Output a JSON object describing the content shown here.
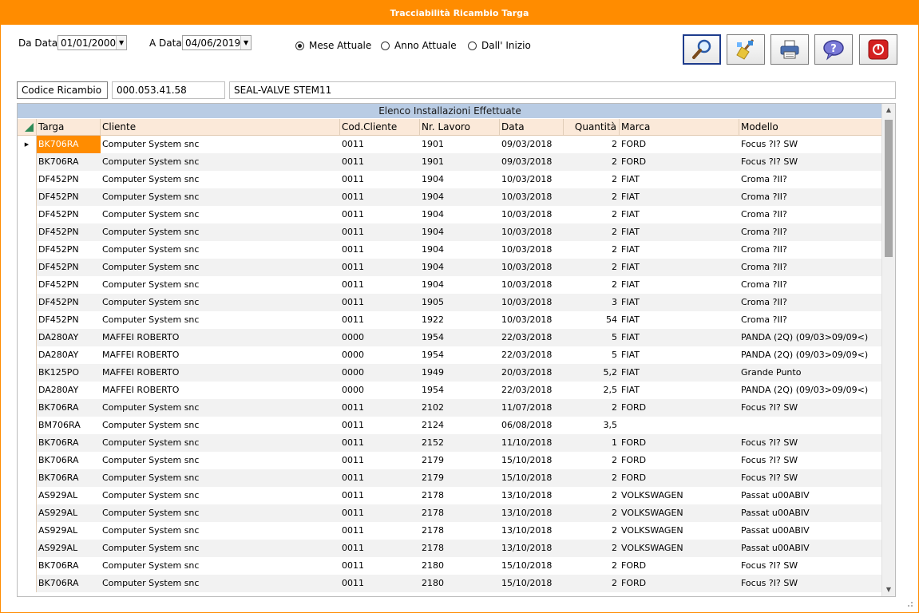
{
  "window": {
    "title": "Tracciabilità Ricambio Targa"
  },
  "filters": {
    "da_data_label": "Da Data",
    "da_data_value": "01/01/2000",
    "a_data_label": "A Data",
    "a_data_value": "04/06/2019",
    "radios": [
      {
        "label": "Mese Attuale",
        "checked": true
      },
      {
        "label": "Anno Attuale",
        "checked": false
      },
      {
        "label": "Dall' Inizio",
        "checked": false
      }
    ]
  },
  "toolbar": {
    "search_icon": "magnifier-icon",
    "clear_icon": "broom-icon",
    "print_icon": "printer-icon",
    "help_icon": "help-bubble-icon",
    "exit_icon": "power-off-icon"
  },
  "part": {
    "label": "Codice Ricambio",
    "code": "000.053.41.58",
    "description": "SEAL-VALVE STEM11"
  },
  "grid": {
    "caption": "Elenco Installazioni Effettuate",
    "columns": [
      "Targa",
      "Cliente",
      "Cod.Cliente",
      "Nr. Lavoro",
      "Data",
      "Quantità",
      "Marca",
      "Modello"
    ],
    "rows": [
      [
        "BK706RA",
        "Computer System snc",
        "0011",
        "1901",
        "09/03/2018",
        "2",
        "FORD",
        "Focus ?I? SW"
      ],
      [
        "BK706RA",
        "Computer System snc",
        "0011",
        "1901",
        "09/03/2018",
        "2",
        "FORD",
        "Focus ?I? SW"
      ],
      [
        "DF452PN",
        "Computer System snc",
        "0011",
        "1904",
        "10/03/2018",
        "2",
        "FIAT",
        "Croma ?II?"
      ],
      [
        "DF452PN",
        "Computer System snc",
        "0011",
        "1904",
        "10/03/2018",
        "2",
        "FIAT",
        "Croma ?II?"
      ],
      [
        "DF452PN",
        "Computer System snc",
        "0011",
        "1904",
        "10/03/2018",
        "2",
        "FIAT",
        "Croma ?II?"
      ],
      [
        "DF452PN",
        "Computer System snc",
        "0011",
        "1904",
        "10/03/2018",
        "2",
        "FIAT",
        "Croma ?II?"
      ],
      [
        "DF452PN",
        "Computer System snc",
        "0011",
        "1904",
        "10/03/2018",
        "2",
        "FIAT",
        "Croma ?II?"
      ],
      [
        "DF452PN",
        "Computer System snc",
        "0011",
        "1904",
        "10/03/2018",
        "2",
        "FIAT",
        "Croma ?II?"
      ],
      [
        "DF452PN",
        "Computer System snc",
        "0011",
        "1904",
        "10/03/2018",
        "2",
        "FIAT",
        "Croma ?II?"
      ],
      [
        "DF452PN",
        "Computer System snc",
        "0011",
        "1905",
        "10/03/2018",
        "3",
        "FIAT",
        "Croma ?II?"
      ],
      [
        "DF452PN",
        "Computer System snc",
        "0011",
        "1922",
        "10/03/2018",
        "54",
        "FIAT",
        "Croma ?II?"
      ],
      [
        "DA280AY",
        "MAFFEI ROBERTO",
        "0000",
        "1954",
        "22/03/2018",
        "5",
        "FIAT",
        "PANDA (2Q) (09/03>09/09<)"
      ],
      [
        "DA280AY",
        "MAFFEI ROBERTO",
        "0000",
        "1954",
        "22/03/2018",
        "5",
        "FIAT",
        "PANDA (2Q) (09/03>09/09<)"
      ],
      [
        "BK125PO",
        "MAFFEI ROBERTO",
        "0000",
        "1949",
        "20/03/2018",
        "5,2",
        "FIAT",
        "Grande Punto"
      ],
      [
        "DA280AY",
        "MAFFEI ROBERTO",
        "0000",
        "1954",
        "22/03/2018",
        "2,5",
        "FIAT",
        "PANDA (2Q) (09/03>09/09<)"
      ],
      [
        "BK706RA",
        "Computer System snc",
        "0011",
        "2102",
        "11/07/2018",
        "2",
        "FORD",
        "Focus ?I? SW"
      ],
      [
        "BM706RA",
        "Computer System snc",
        "0011",
        "2124",
        "06/08/2018",
        "3,5",
        "",
        ""
      ],
      [
        "BK706RA",
        "Computer System snc",
        "0011",
        "2152",
        "11/10/2018",
        "1",
        "FORD",
        "Focus ?I? SW"
      ],
      [
        "BK706RA",
        "Computer System snc",
        "0011",
        "2179",
        "15/10/2018",
        "2",
        "FORD",
        "Focus ?I? SW"
      ],
      [
        "BK706RA",
        "Computer System snc",
        "0011",
        "2179",
        "15/10/2018",
        "2",
        "FORD",
        "Focus ?I? SW"
      ],
      [
        "AS929AL",
        "Computer System snc",
        "0011",
        "2178",
        "13/10/2018",
        "2",
        "VOLKSWAGEN",
        "Passat u00ABIV"
      ],
      [
        "AS929AL",
        "Computer System snc",
        "0011",
        "2178",
        "13/10/2018",
        "2",
        "VOLKSWAGEN",
        "Passat u00ABIV"
      ],
      [
        "AS929AL",
        "Computer System snc",
        "0011",
        "2178",
        "13/10/2018",
        "2",
        "VOLKSWAGEN",
        "Passat u00ABIV"
      ],
      [
        "AS929AL",
        "Computer System snc",
        "0011",
        "2178",
        "13/10/2018",
        "2",
        "VOLKSWAGEN",
        "Passat u00ABIV"
      ],
      [
        "BK706RA",
        "Computer System snc",
        "0011",
        "2180",
        "15/10/2018",
        "2",
        "FORD",
        "Focus ?I? SW"
      ],
      [
        "BK706RA",
        "Computer System snc",
        "0011",
        "2180",
        "15/10/2018",
        "2",
        "FORD",
        "Focus ?I? SW"
      ]
    ]
  },
  "colors": {
    "accent": "#ff8c00",
    "caption": "#b9cce4",
    "header": "#fbe9d9"
  }
}
